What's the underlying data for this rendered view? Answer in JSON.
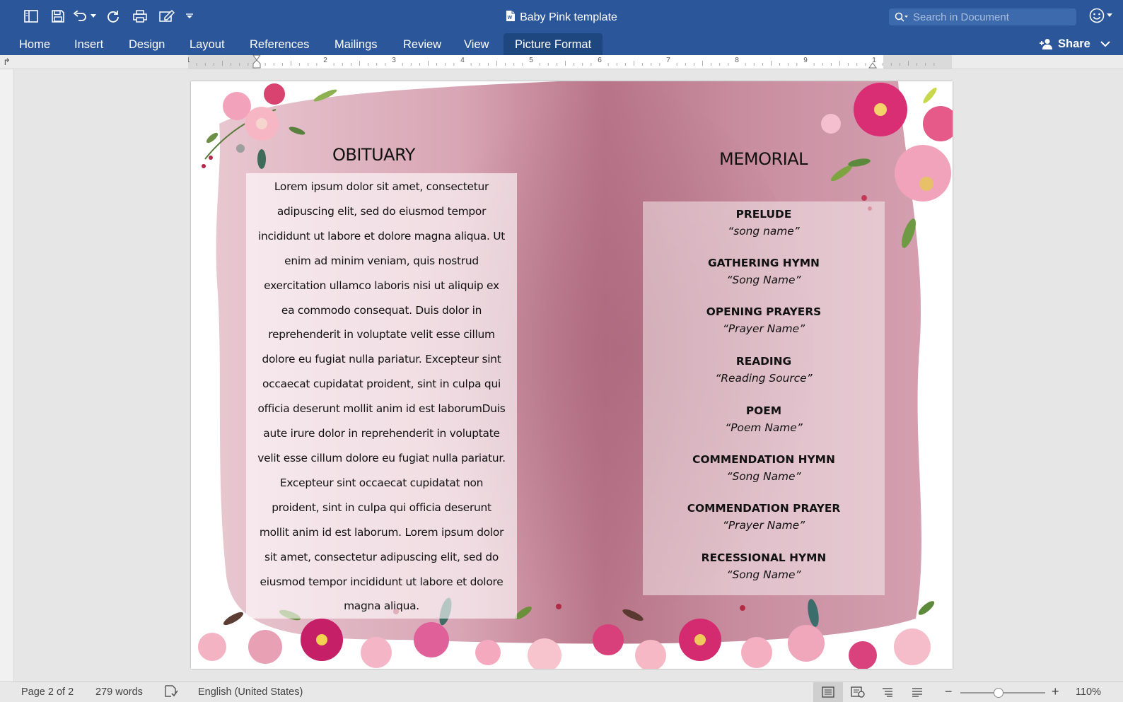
{
  "window": {
    "title": "Baby Pink template",
    "search_placeholder": "Search in Document"
  },
  "quick_access": [
    {
      "name": "sidebar-toggle-icon"
    },
    {
      "name": "save-icon"
    },
    {
      "name": "undo-icon"
    },
    {
      "name": "undo-dropdown-icon"
    },
    {
      "name": "redo-icon"
    },
    {
      "name": "print-icon"
    },
    {
      "name": "edit-icon"
    },
    {
      "name": "customize-dropdown-icon"
    }
  ],
  "ribbon": {
    "tabs": [
      "Home",
      "Insert",
      "Design",
      "Layout",
      "References",
      "Mailings",
      "Review",
      "View",
      "Picture Format"
    ],
    "active_tab": "Picture Format",
    "share_label": "Share"
  },
  "ruler": {
    "numbers": [
      "1",
      "1",
      "2",
      "3",
      "4",
      "5",
      "6",
      "7",
      "8",
      "9",
      "1"
    ]
  },
  "document": {
    "obituary": {
      "heading": "OBITUARY",
      "lines": [
        "Lorem ipsum dolor sit amet, consectetur",
        "adipuscing elit, sed do eiusmod tempor",
        "incididunt ut labore et dolore magna aliqua. Ut",
        "enim ad minim veniam, quis nostrud",
        "exercitation ullamco laboris nisi ut aliquip ex",
        "ea commodo consequat. Duis dolor in",
        "reprehenderit in voluptate velit esse cillum",
        "dolore eu fugiat nulla pariatur. Excepteur sint",
        "occaecat cupidatat proident, sint in culpa qui",
        "officia deserunt mollit anim id est laborumDuis",
        "aute irure dolor in reprehenderit in voluptate",
        "velit esse cillum dolore eu fugiat nulla pariatur.",
        "Excepteur sint occaecat cupidatat non",
        "proident, sint in culpa qui officia deserunt",
        "mollit anim id est laborum. Lorem ipsum dolor",
        "sit amet, consectetur adipuscing elit, sed do",
        "eiusmod tempor incididunt ut labore et dolore",
        "magna aliqua."
      ]
    },
    "memorial": {
      "heading": "MEMORIAL",
      "program": [
        {
          "title": "PRELUDE",
          "name": "“song name”"
        },
        {
          "title": "GATHERING HYMN",
          "name": "“Song Name”"
        },
        {
          "title": "OPENING PRAYERS",
          "name": "“Prayer Name”"
        },
        {
          "title": "READING",
          "name": "“Reading Source”"
        },
        {
          "title": "POEM",
          "name": "“Poem Name”"
        },
        {
          "title": "COMMENDATION HYMN",
          "name": "“Song Name”"
        },
        {
          "title": "COMMENDATION PRAYER",
          "name": "“Prayer Name”"
        },
        {
          "title": "RECESSIONAL HYMN",
          "name": "“Song Name”"
        }
      ]
    }
  },
  "status": {
    "page": "Page 2 of 2",
    "words": "279 words",
    "language": "English (United States)",
    "zoom": "110%",
    "zoom_level": 0.45
  },
  "colors": {
    "ribbon": "#2b579a",
    "active_tab": "#1e4780",
    "wash": "#c8889c"
  }
}
